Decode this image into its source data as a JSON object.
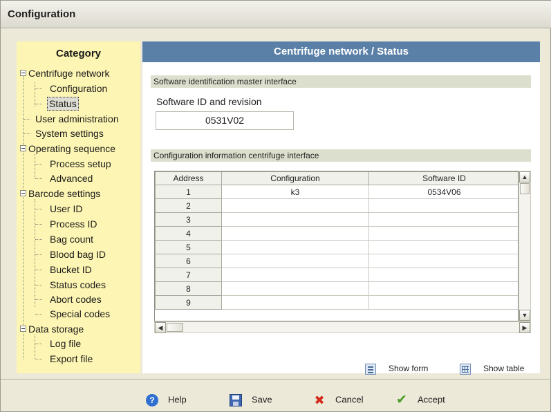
{
  "window": {
    "title": "Configuration"
  },
  "sidebar": {
    "heading": "Category",
    "tree": [
      {
        "label": "Centrifuge network",
        "expanded": true,
        "children": [
          {
            "label": "Configuration",
            "selected": false
          },
          {
            "label": "Status",
            "selected": true
          }
        ]
      },
      {
        "label": "User administration"
      },
      {
        "label": "System settings"
      },
      {
        "label": "Operating sequence",
        "expanded": true,
        "children": [
          {
            "label": "Process setup"
          },
          {
            "label": "Advanced"
          }
        ]
      },
      {
        "label": "Barcode settings",
        "expanded": true,
        "children": [
          {
            "label": "User ID"
          },
          {
            "label": "Process ID"
          },
          {
            "label": "Bag count"
          },
          {
            "label": "Blood bag ID"
          },
          {
            "label": "Bucket ID"
          },
          {
            "label": "Status codes"
          },
          {
            "label": "Abort codes"
          },
          {
            "label": "Special codes"
          }
        ]
      },
      {
        "label": "Data storage",
        "expanded": true,
        "children": [
          {
            "label": "Log file"
          },
          {
            "label": "Export file"
          }
        ]
      }
    ]
  },
  "main": {
    "header": "Centrifuge network / Status",
    "section1": "Software identification master interface",
    "sw_label": "Software ID and revision",
    "sw_value": "0531V02",
    "section2": "Configuration information centrifuge interface",
    "grid": {
      "columns": [
        "Address",
        "Configuration",
        "Software ID"
      ],
      "rows": [
        [
          "1",
          "k3",
          "0534V06"
        ],
        [
          "2",
          "",
          ""
        ],
        [
          "3",
          "",
          ""
        ],
        [
          "4",
          "",
          ""
        ],
        [
          "5",
          "",
          ""
        ],
        [
          "6",
          "",
          ""
        ],
        [
          "7",
          "",
          ""
        ],
        [
          "8",
          "",
          ""
        ],
        [
          "9",
          "",
          ""
        ]
      ]
    },
    "view_buttons": {
      "show_form": "Show form",
      "show_table": "Show table"
    }
  },
  "footer": {
    "help": "Help",
    "save": "Save",
    "cancel": "Cancel",
    "accept": "Accept"
  },
  "colors": {
    "header_blue": "#5b80a8",
    "sidebar_yellow": "#fdf5b3",
    "section_band": "#dcdfcd"
  }
}
